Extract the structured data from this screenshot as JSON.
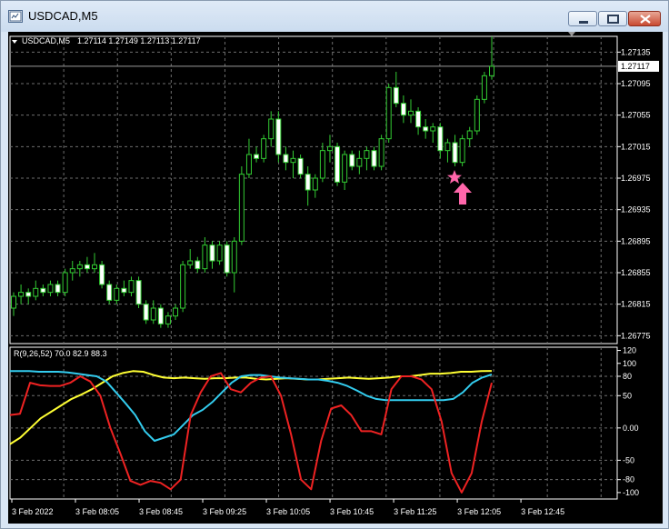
{
  "window": {
    "title": "USDCAD,M5",
    "icon": "chart-window-icon",
    "buttons": [
      "minimize",
      "maximize",
      "close"
    ]
  },
  "main_chart": {
    "symbol_label": "USDCAD,M5",
    "ohlc_label": "1.27114 1.27149 1.27113 1.27117",
    "current_price": "1.27117",
    "price_ticks": [
      "1.27135",
      "1.27095",
      "1.27055",
      "1.27015",
      "1.26975",
      "1.26935",
      "1.26895",
      "1.26855",
      "1.26815",
      "1.26775"
    ],
    "colors": {
      "bull": "#ffffff",
      "bear": "#ffffff",
      "wick": "#33cc33",
      "grid": "#808080",
      "star": "#ff66aa",
      "arrow": "#ff66aa"
    }
  },
  "indicator": {
    "label": "R(9,26,52) 70.0 82.9 88.3",
    "ticks": [
      "120",
      "100",
      "80",
      "50",
      "0.00",
      "-50",
      "-80",
      "-100"
    ],
    "series_colors": {
      "yellow": "#ffff33",
      "cyan": "#33ccee",
      "red": "#ee2222"
    }
  },
  "x_axis": {
    "labels": [
      "3 Feb 2022",
      "3 Feb 08:05",
      "3 Feb 08:45",
      "3 Feb 09:25",
      "3 Feb 10:05",
      "3 Feb 10:45",
      "3 Feb 11:25",
      "3 Feb 12:05",
      "3 Feb 12:45"
    ]
  },
  "chart_data": {
    "type": "line",
    "title": "",
    "price_range": [
      1.26765,
      1.27155
    ],
    "indicator_range": [
      -110,
      125
    ],
    "candles": [
      [
        1.2681,
        1.2683,
        1.268,
        1.26825
      ],
      [
        1.26825,
        1.2684,
        1.26815,
        1.2683
      ],
      [
        1.2683,
        1.26835,
        1.26815,
        1.26825
      ],
      [
        1.26825,
        1.26845,
        1.2682,
        1.26835
      ],
      [
        1.26835,
        1.2684,
        1.26825,
        1.2683
      ],
      [
        1.2683,
        1.26845,
        1.26825,
        1.2684
      ],
      [
        1.2684,
        1.26845,
        1.26825,
        1.2683
      ],
      [
        1.2683,
        1.2686,
        1.26825,
        1.26855
      ],
      [
        1.26855,
        1.2687,
        1.26845,
        1.2686
      ],
      [
        1.2686,
        1.2687,
        1.2685,
        1.26865
      ],
      [
        1.26865,
        1.26875,
        1.26855,
        1.2686
      ],
      [
        1.2686,
        1.2688,
        1.26855,
        1.26865
      ],
      [
        1.26865,
        1.2687,
        1.26835,
        1.2684
      ],
      [
        1.2684,
        1.26845,
        1.26815,
        1.2682
      ],
      [
        1.2682,
        1.2684,
        1.26815,
        1.26835
      ],
      [
        1.26835,
        1.26845,
        1.26825,
        1.2683
      ],
      [
        1.2683,
        1.2685,
        1.26825,
        1.26845
      ],
      [
        1.26845,
        1.2685,
        1.2681,
        1.26815
      ],
      [
        1.26815,
        1.2682,
        1.2679,
        1.26795
      ],
      [
        1.26795,
        1.2682,
        1.2679,
        1.2681
      ],
      [
        1.2681,
        1.26815,
        1.26785,
        1.2679
      ],
      [
        1.2679,
        1.26805,
        1.26785,
        1.268
      ],
      [
        1.268,
        1.26815,
        1.26795,
        1.2681
      ],
      [
        1.2681,
        1.2687,
        1.26805,
        1.26865
      ],
      [
        1.26865,
        1.26885,
        1.2686,
        1.2687
      ],
      [
        1.2687,
        1.26875,
        1.26855,
        1.2686
      ],
      [
        1.2686,
        1.269,
        1.26855,
        1.2689
      ],
      [
        1.2689,
        1.26895,
        1.2686,
        1.2687
      ],
      [
        1.2687,
        1.26895,
        1.26865,
        1.2689
      ],
      [
        1.2689,
        1.26895,
        1.2685,
        1.26855
      ],
      [
        1.26855,
        1.269,
        1.2683,
        1.26895
      ],
      [
        1.26895,
        1.2699,
        1.2689,
        1.2698
      ],
      [
        1.2698,
        1.27025,
        1.26975,
        1.27005
      ],
      [
        1.27005,
        1.27015,
        1.26995,
        1.27
      ],
      [
        1.27,
        1.2703,
        1.26995,
        1.27025
      ],
      [
        1.27025,
        1.2706,
        1.27015,
        1.2705
      ],
      [
        1.2705,
        1.2706,
        1.26995,
        1.27005
      ],
      [
        1.27005,
        1.27015,
        1.26985,
        1.26995
      ],
      [
        1.26995,
        1.2701,
        1.26975,
        1.27
      ],
      [
        1.27,
        1.27005,
        1.26975,
        1.2698
      ],
      [
        1.2698,
        1.2699,
        1.2694,
        1.2696
      ],
      [
        1.2696,
        1.2698,
        1.2695,
        1.26975
      ],
      [
        1.26975,
        1.2702,
        1.2697,
        1.2701
      ],
      [
        1.2701,
        1.2703,
        1.26995,
        1.27015
      ],
      [
        1.27015,
        1.2702,
        1.26965,
        1.2697
      ],
      [
        1.2697,
        1.2701,
        1.2696,
        1.27005
      ],
      [
        1.27005,
        1.2701,
        1.26985,
        1.2699
      ],
      [
        1.2699,
        1.2701,
        1.2698,
        1.27
      ],
      [
        1.27,
        1.27015,
        1.26985,
        1.2701
      ],
      [
        1.2701,
        1.27015,
        1.26985,
        1.2699
      ],
      [
        1.2699,
        1.2703,
        1.26985,
        1.27025
      ],
      [
        1.27025,
        1.27095,
        1.2702,
        1.2709
      ],
      [
        1.2709,
        1.2711,
        1.27065,
        1.2707
      ],
      [
        1.2707,
        1.2708,
        1.27045,
        1.27055
      ],
      [
        1.27055,
        1.27075,
        1.27045,
        1.2706
      ],
      [
        1.2706,
        1.27065,
        1.2703,
        1.2704
      ],
      [
        1.2704,
        1.2705,
        1.27025,
        1.27035
      ],
      [
        1.27035,
        1.27045,
        1.2702,
        1.2704
      ],
      [
        1.2704,
        1.27045,
        1.27,
        1.2701
      ],
      [
        1.2701,
        1.27025,
        1.26995,
        1.2702
      ],
      [
        1.2702,
        1.2703,
        1.2699,
        1.26995
      ],
      [
        1.26995,
        1.2703,
        1.2699,
        1.27025
      ],
      [
        1.27025,
        1.2704,
        1.27015,
        1.27035
      ],
      [
        1.27035,
        1.2708,
        1.2703,
        1.27075
      ],
      [
        1.27075,
        1.2711,
        1.2707,
        1.27105
      ],
      [
        1.27105,
        1.27155,
        1.271,
        1.27117
      ]
    ],
    "series": [
      {
        "values": [
          -25,
          -15,
          0,
          15,
          25,
          35,
          45,
          52,
          60,
          70,
          80,
          85,
          88,
          87,
          82,
          78,
          77,
          78,
          77,
          76,
          77,
          77,
          78,
          78,
          76,
          75,
          76,
          77,
          76,
          75,
          75,
          76,
          77,
          78,
          77,
          76,
          77,
          78,
          80,
          80,
          82,
          84,
          84,
          85,
          87,
          87,
          88,
          88.3
        ]
      },
      {
        "values": [
          88,
          88,
          88,
          87,
          87,
          87,
          86,
          84,
          82,
          80,
          72,
          55,
          38,
          20,
          -5,
          -20,
          -15,
          -10,
          5,
          20,
          28,
          40,
          55,
          70,
          80,
          82,
          82,
          80,
          78,
          77,
          76,
          75,
          75,
          73,
          70,
          65,
          58,
          50,
          45,
          43,
          43,
          43,
          43,
          43,
          43,
          43,
          45,
          55,
          70,
          78,
          82.9
        ]
      },
      {
        "values": [
          20,
          22,
          70,
          66,
          65,
          65,
          70,
          80,
          72,
          50,
          0,
          -40,
          -82,
          -88,
          -82,
          -85,
          -95,
          -80,
          20,
          55,
          80,
          85,
          60,
          55,
          70,
          78,
          80,
          50,
          -10,
          -80,
          -95,
          -20,
          30,
          35,
          20,
          -5,
          -5,
          -10,
          60,
          80,
          80,
          75,
          60,
          10,
          -70,
          -100,
          -70,
          10,
          70
        ]
      }
    ]
  }
}
